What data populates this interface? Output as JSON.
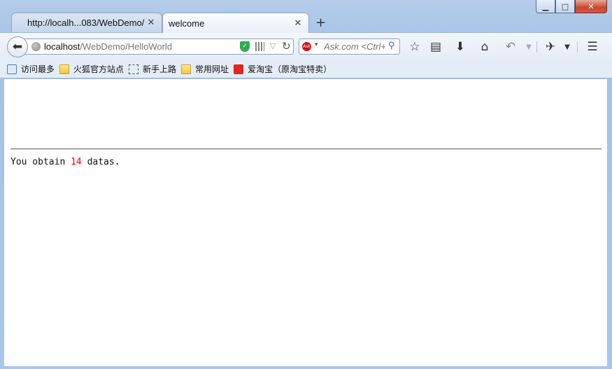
{
  "window": {
    "minimize_label": "▁",
    "maximize_label": "□",
    "close_label": "✕"
  },
  "tabs": [
    {
      "label": "http://localh...083/WebDemo/",
      "close": "✕"
    },
    {
      "label": "welcome",
      "close": "✕"
    }
  ],
  "newtab_label": "+",
  "nav": {
    "url_host": "localhost",
    "url_path": "/WebDemo/HelloWorld",
    "search_placeholder": "Ask.com <Ctrl+K>",
    "ask_badge": "Ask",
    "icons": [
      "back-arrow-icon",
      "globe-icon",
      "shield-icon",
      "qr-code-icon",
      "dropdown-icon",
      "reload-icon",
      "ask-logo-icon",
      "search-icon",
      "bookmark-star-icon",
      "reader-icon",
      "download-icon",
      "home-icon",
      "undo-icon",
      "extension-icon",
      "menu-icon"
    ]
  },
  "bookmarks": [
    {
      "label": "访问最多",
      "icon": "most-visited-icon"
    },
    {
      "label": "火狐官方站点",
      "icon": "folder-icon"
    },
    {
      "label": "新手上路",
      "icon": "dashed-page-icon"
    },
    {
      "label": "常用网址",
      "icon": "folder-icon"
    },
    {
      "label": "爱淘宝（原淘宝特卖）",
      "icon": "taobao-icon"
    }
  ],
  "page": {
    "text_before": "You obtain ",
    "count": "14",
    "text_after": " datas."
  },
  "colors": {
    "count_highlight": "#e00000",
    "frame": "#a6c2e6"
  }
}
